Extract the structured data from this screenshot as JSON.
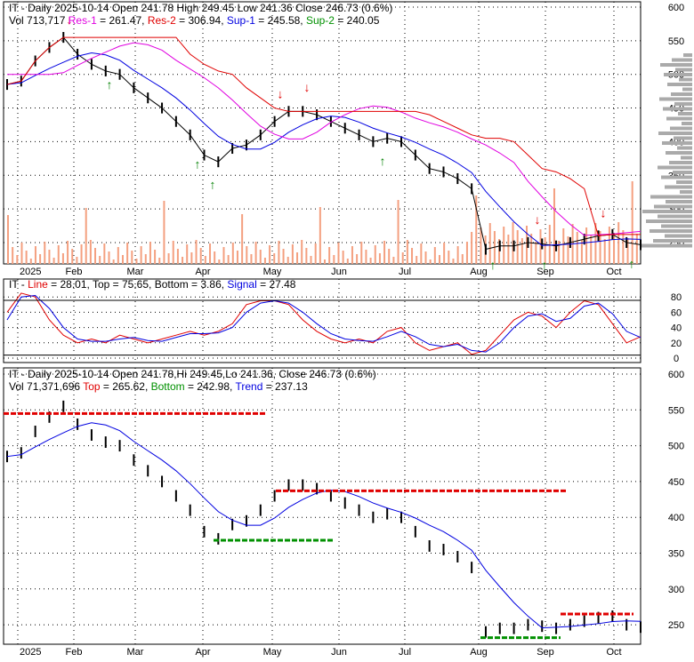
{
  "panel1": {
    "line1": "IT - Daily 2025-10-14 Open 241.78  High 249.45  Low 241.36  Close 246.73 (0.6%)",
    "vol": "Vol 713,717",
    "res1_label": "Res-1",
    "res1": " = 261.47, ",
    "res2_label": "Res-2",
    "res2": " = 306.94, ",
    "sup1_label": "Sup-1",
    "sup1": " = 245.58, ",
    "sup2_label": "Sup-2",
    "sup2": " = 240.05"
  },
  "panel2": {
    "prefix": "IT - ",
    "line_label": "Line",
    "line": " = 28.01, Top = 75.65, Bottom = 3.86, ",
    "signal_label": "Signal",
    "signal": " = 27.48"
  },
  "panel3": {
    "line1": "IT - Daily 2025-10-14 Open 241.78,Hi 249.45,Lo 241.36, Close 246.73 (0.6%)",
    "vol": "Vol 71,371,696 ",
    "top_label": "Top",
    "top": " = 265.62, ",
    "bottom_label": "Bottom",
    "bottom": " = 242.98, ",
    "trend_label": "Trend",
    "trend": " = 237.13"
  },
  "chart_data": [
    {
      "type": "line",
      "title": "IT - Daily price with volume, support/resistance",
      "ylim": [
        220,
        600
      ],
      "yticks": [
        250,
        300,
        350,
        400,
        450,
        500,
        550,
        600
      ],
      "xticks": [
        "2025",
        "Feb",
        "Mar",
        "Apr",
        "May",
        "Jun",
        "Jul",
        "Aug",
        "Sep",
        "Oct"
      ],
      "close": [
        485,
        490,
        520,
        540,
        555,
        530,
        515,
        505,
        500,
        480,
        465,
        450,
        430,
        410,
        380,
        370,
        390,
        395,
        410,
        430,
        445,
        445,
        440,
        430,
        420,
        410,
        400,
        405,
        400,
        380,
        360,
        355,
        345,
        330,
        240,
        245,
        245,
        250,
        248,
        245,
        250,
        255,
        260,
        262,
        250,
        246.73
      ]
    },
    {
      "type": "line",
      "title": "Oscillator",
      "ylim": [
        0,
        90
      ],
      "yticks": [
        0,
        20,
        40,
        60,
        80
      ],
      "line": [
        60,
        85,
        80,
        50,
        30,
        20,
        25,
        20,
        30,
        25,
        20,
        25,
        30,
        35,
        30,
        35,
        45,
        70,
        75,
        75,
        70,
        50,
        35,
        25,
        20,
        25,
        20,
        35,
        40,
        20,
        10,
        15,
        20,
        5,
        10,
        30,
        50,
        60,
        55,
        40,
        60,
        75,
        70,
        45,
        20,
        28
      ],
      "signal": [
        50,
        80,
        82,
        65,
        40,
        25,
        22,
        22,
        25,
        27,
        23,
        22,
        27,
        32,
        32,
        33,
        40,
        60,
        72,
        75,
        72,
        60,
        45,
        32,
        25,
        23,
        22,
        28,
        35,
        28,
        18,
        15,
        18,
        10,
        8,
        20,
        40,
        55,
        58,
        48,
        52,
        68,
        72,
        58,
        35,
        27
      ]
    },
    {
      "type": "line",
      "title": "IT - Daily trend",
      "ylim": [
        220,
        600
      ],
      "yticks": [
        250,
        300,
        350,
        400,
        450,
        500,
        550,
        600
      ]
    }
  ],
  "colors": {
    "res1": "#e000e0",
    "res2": "#e00000",
    "sup1": "#0000e0",
    "sup2": "#009000",
    "volume": "#f4a080"
  }
}
